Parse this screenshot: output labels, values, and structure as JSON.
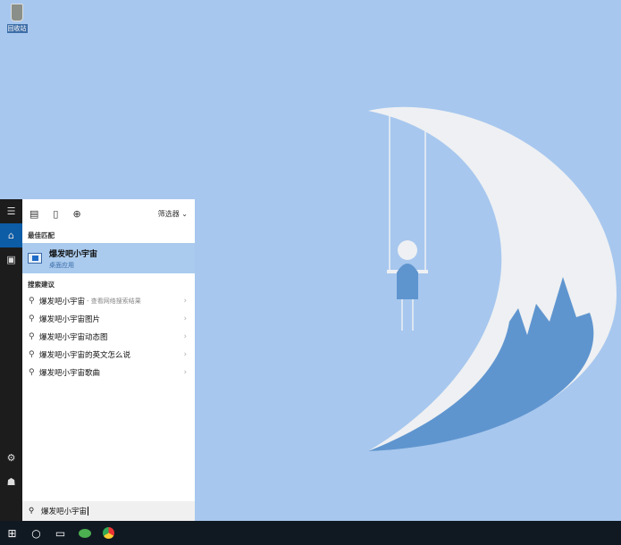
{
  "desktop": {
    "recycle_bin_label": "回收站"
  },
  "rail": {
    "menu_icon": "hamburger-icon",
    "home_icon": "home-icon",
    "notebook_icon": "notebook-icon",
    "settings_icon": "gear-icon",
    "feedback_icon": "feedback-icon"
  },
  "panel": {
    "filter_label": "筛选器",
    "best_match_heading": "最佳匹配",
    "best_match": {
      "title": "爆发吧小宇宙",
      "subtitle": "桌面应用"
    },
    "suggestions_heading": "搜索建议",
    "suggestions": [
      {
        "text": "爆发吧小宇宙",
        "sub": "- 查看网络搜索结果"
      },
      {
        "text": "爆发吧小宇宙图片"
      },
      {
        "text": "爆发吧小宇宙动态图"
      },
      {
        "text": "爆发吧小宇宙的英文怎么说"
      },
      {
        "text": "爆发吧小宇宙歌曲"
      }
    ],
    "search_value": "爆发吧小宇宙"
  },
  "taskbar": {
    "icons": [
      "windows-start-icon",
      "cortana-icon",
      "task-view-icon",
      "wechat-icon",
      "chrome-icon"
    ]
  }
}
